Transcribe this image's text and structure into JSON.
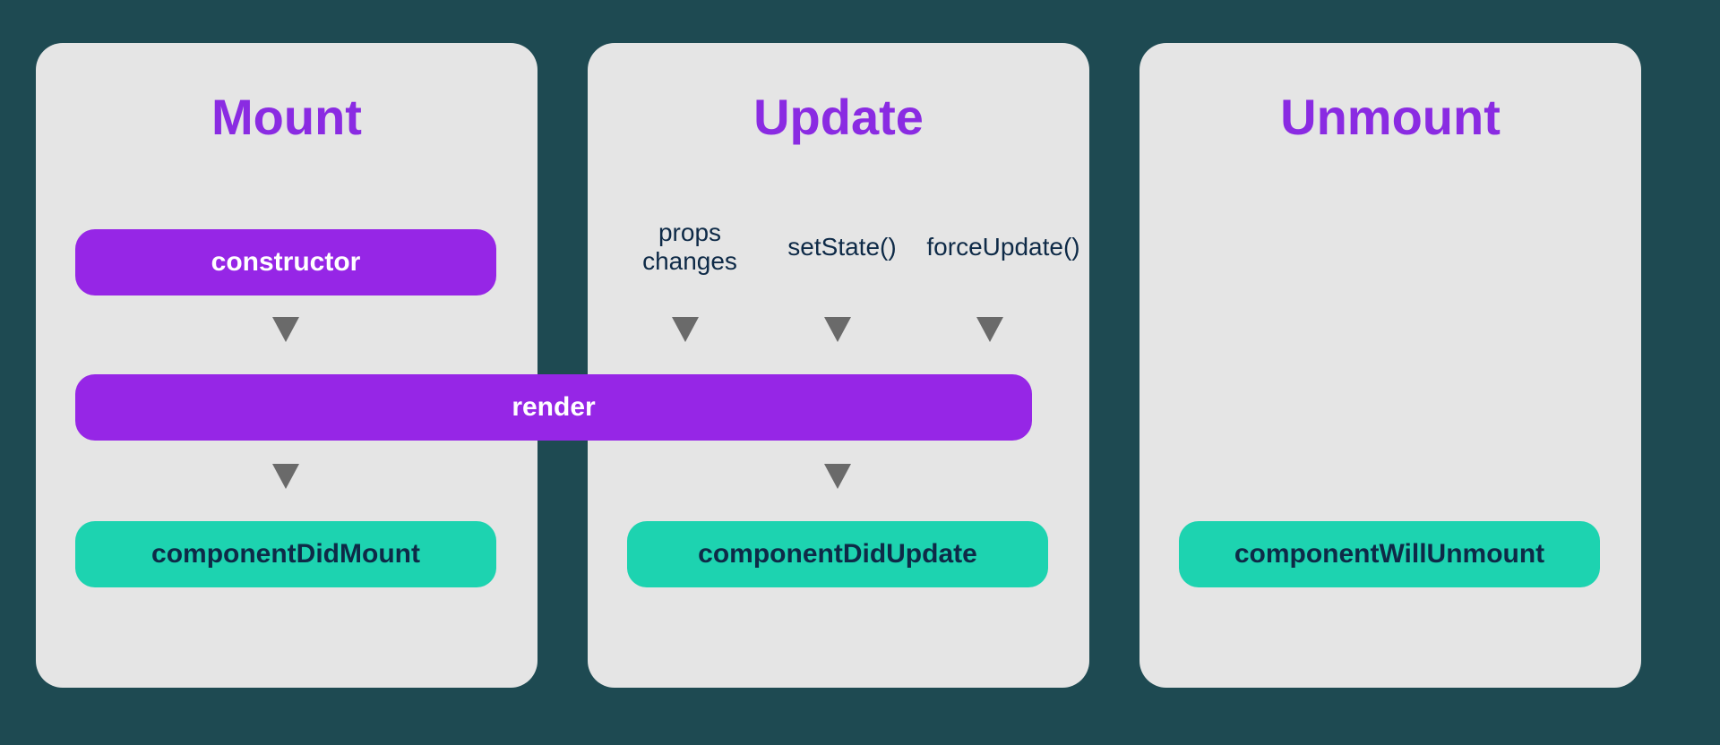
{
  "colors": {
    "page_bg": "#1e4a52",
    "panel_bg": "#e5e5e5",
    "purple_pill": "#9626e6",
    "teal_pill": "#1dd3b0",
    "title_purple": "#8a2be2",
    "pill_text_light": "#ffffff",
    "pill_text_dark": "#0e2a47",
    "arrow": "#6a6a6a"
  },
  "panels": {
    "mount": {
      "title": "Mount"
    },
    "update": {
      "title": "Update"
    },
    "unmount": {
      "title": "Unmount"
    }
  },
  "pills": {
    "constructor_label": "constructor",
    "render_label": "render",
    "cdm_label": "componentDidMount",
    "cdu_label": "componentDidUpdate",
    "cwu_label": "componentWillUnmount"
  },
  "triggers": {
    "t1_line1": "props",
    "t1_line2": "changes",
    "t2": "setState()",
    "t3": "forceUpdate()"
  }
}
